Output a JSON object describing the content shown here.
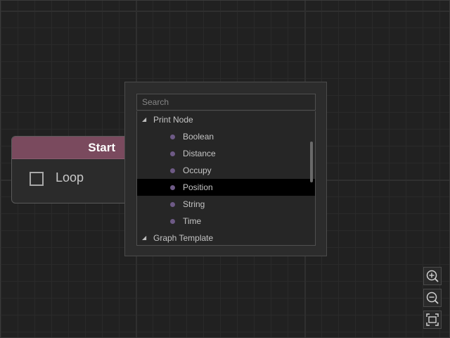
{
  "node": {
    "title": "Start",
    "header_color": "#7a4a5e",
    "checkbox_label": "Loop",
    "checkbox_checked": false
  },
  "search": {
    "placeholder": "Search",
    "value": ""
  },
  "tree": {
    "groups": [
      {
        "label": "Print Node",
        "expanded": true,
        "items": [
          "Boolean",
          "Distance",
          "Occupy",
          "Position",
          "String",
          "Time"
        ]
      },
      {
        "label": "Graph Template",
        "expanded": true,
        "items": []
      }
    ],
    "selected_item": "Position",
    "item_dot_color": "#6e5a86"
  },
  "zoom": {
    "zoom_in_icon": "zoom-in-icon",
    "zoom_out_icon": "zoom-out-icon",
    "fit_icon": "fit-to-screen-icon"
  }
}
